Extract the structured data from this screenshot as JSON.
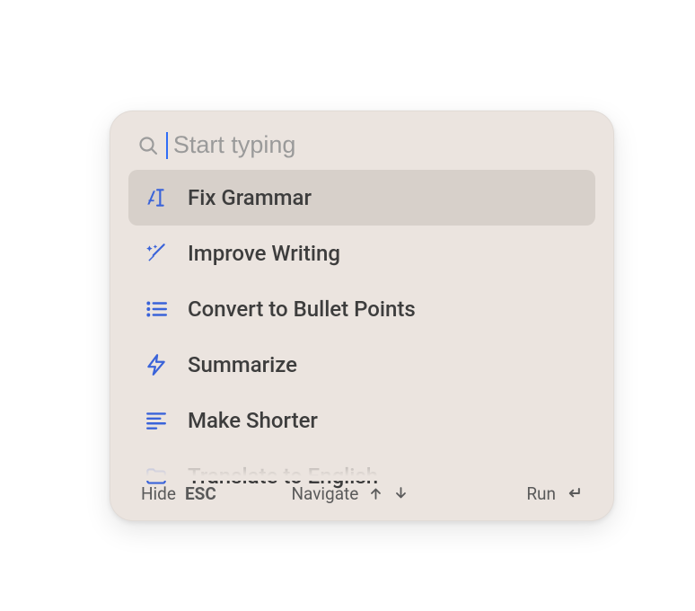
{
  "search": {
    "placeholder": "Start typing",
    "value": ""
  },
  "items": [
    {
      "icon": "text-cursor-icon",
      "label": "Fix Grammar",
      "selected": true
    },
    {
      "icon": "magic-wand-icon",
      "label": "Improve Writing",
      "selected": false
    },
    {
      "icon": "bullet-list-icon",
      "label": "Convert to Bullet Points",
      "selected": false
    },
    {
      "icon": "bolt-icon",
      "label": "Summarize",
      "selected": false
    },
    {
      "icon": "align-left-icon",
      "label": "Make Shorter",
      "selected": false
    },
    {
      "icon": "folder-icon",
      "label": "Translate to English",
      "selected": false
    }
  ],
  "footer": {
    "hide_label": "Hide",
    "hide_key": "ESC",
    "navigate_label": "Navigate",
    "run_label": "Run"
  },
  "colors": {
    "panel_bg": "#ebe4df",
    "selected_bg": "#d7d0ca",
    "accent": "#3a63d9",
    "text": "#3d3d3d",
    "placeholder": "#9a9a9a"
  }
}
